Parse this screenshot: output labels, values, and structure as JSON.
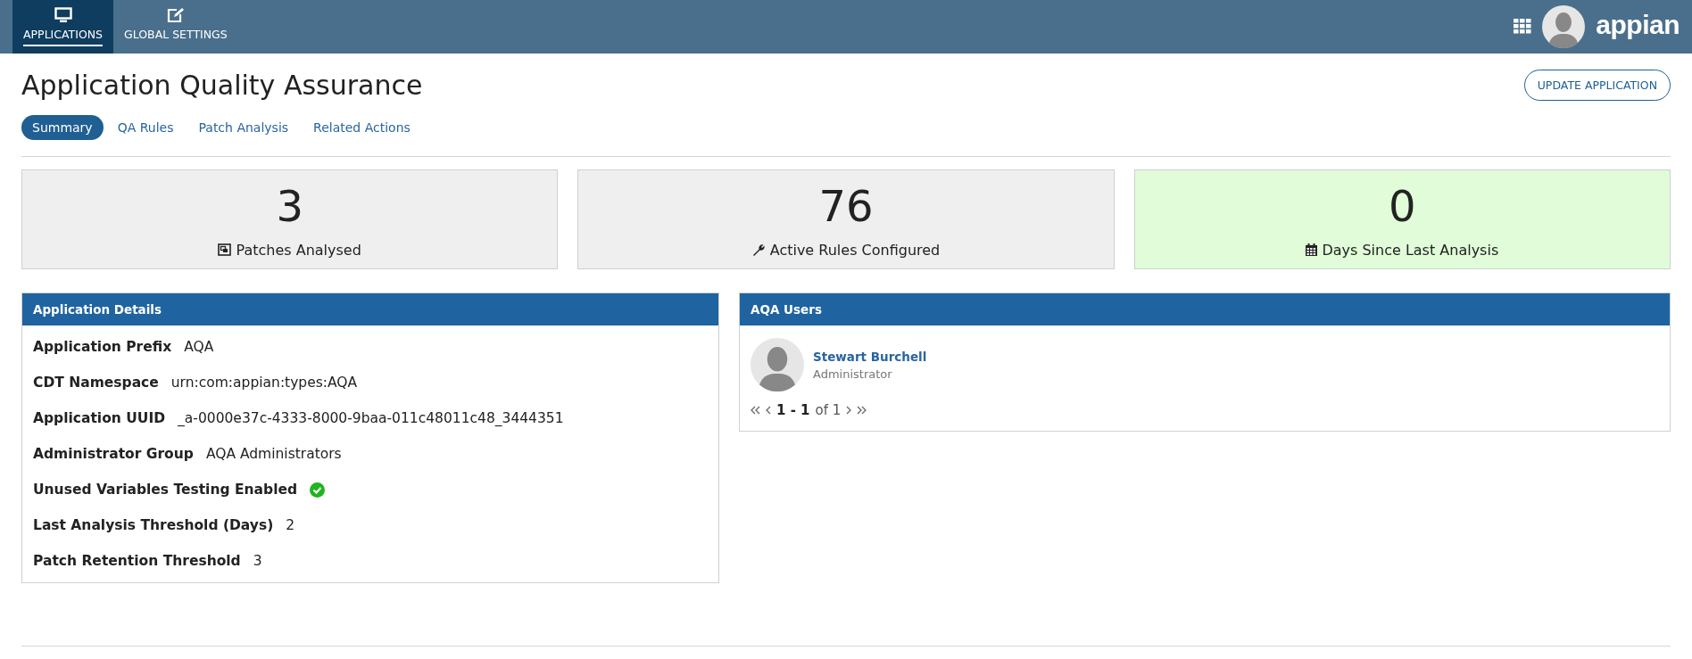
{
  "nav": {
    "items": [
      {
        "label": "APPLICATIONS",
        "kind": "monitor",
        "selected": true
      },
      {
        "label": "GLOBAL SETTINGS",
        "kind": "edit",
        "selected": false
      }
    ],
    "logo": "appian"
  },
  "page": {
    "title": "Application Quality Assurance",
    "action_button": "UPDATE APPLICATION"
  },
  "tabs": [
    {
      "label": "Summary",
      "selected": true
    },
    {
      "label": "QA Rules",
      "selected": false
    },
    {
      "label": "Patch Analysis",
      "selected": false
    },
    {
      "label": "Related Actions",
      "selected": false
    }
  ],
  "stats": [
    {
      "value": "3",
      "label": "Patches Analysed",
      "kind": "patch",
      "highlighted": false
    },
    {
      "value": "76",
      "label": "Active Rules Configured",
      "kind": "wrench",
      "highlighted": false
    },
    {
      "value": "0",
      "label": "Days Since Last Analysis",
      "kind": "calendar",
      "highlighted": true
    }
  ],
  "application_details": {
    "title": "Application Details",
    "rows": [
      {
        "kind": "text",
        "label": "Application Prefix",
        "value": "AQA"
      },
      {
        "kind": "text",
        "label": "CDT Namespace",
        "value": "urn:com:appian:types:AQA"
      },
      {
        "kind": "text",
        "label": "Application UUID",
        "value": "_a-0000e37c-4333-8000-9baa-011c48011c48_3444351"
      },
      {
        "kind": "text",
        "label": "Administrator Group",
        "value": "AQA Administrators"
      },
      {
        "kind": "check",
        "label": "Unused Variables Testing Enabled",
        "checked": true
      },
      {
        "kind": "text",
        "label": "Last Analysis Threshold (Days)",
        "value": "2"
      },
      {
        "kind": "text",
        "label": "Patch Retention Threshold",
        "value": "3"
      }
    ]
  },
  "aqa_users": {
    "title": "AQA Users",
    "users": [
      {
        "name": "Stewart Burchell",
        "role": "Administrator"
      }
    ],
    "pager": {
      "range": "1 - 1",
      "total": "of 1"
    }
  }
}
